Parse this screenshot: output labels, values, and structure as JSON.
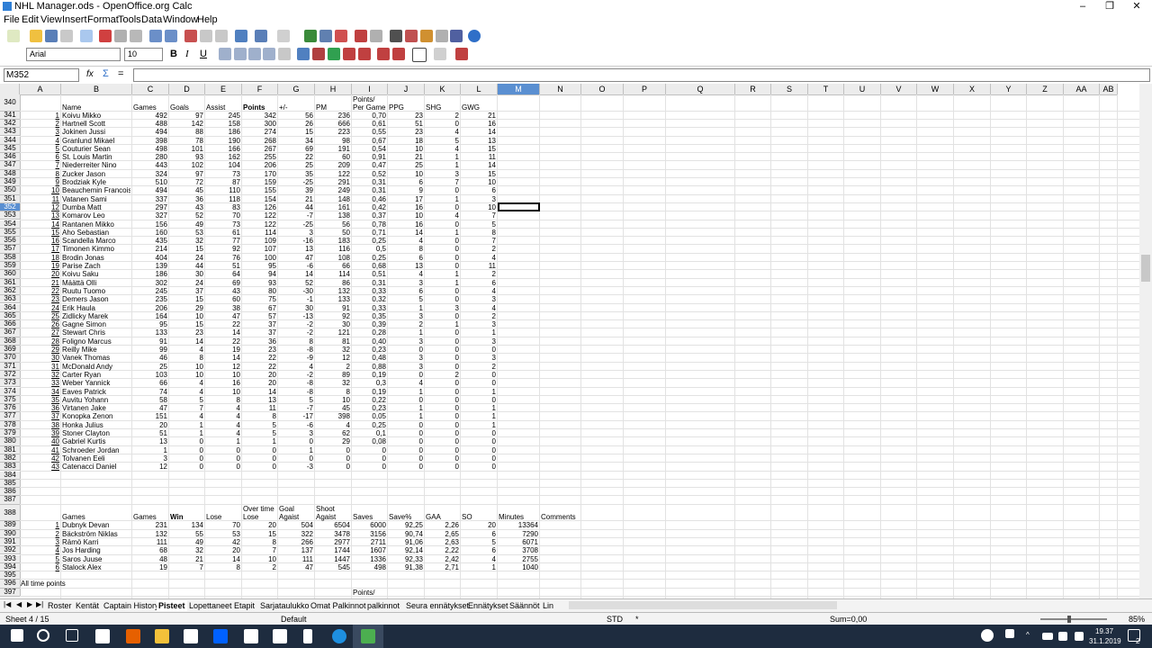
{
  "window": {
    "title": "NHL Manager.ods - OpenOffice.org Calc",
    "min": "–",
    "max": "❐",
    "close": "✕"
  },
  "menu": [
    "File",
    "Edit",
    "View",
    "Insert",
    "Format",
    "Tools",
    "Data",
    "Window",
    "Help"
  ],
  "format_toolbar": {
    "font": "Arial",
    "size": "10",
    "bold": "B",
    "italic": "I",
    "underline": "U"
  },
  "formula_bar": {
    "cell_ref": "M352",
    "fx": "fx",
    "sum": "Σ",
    "eq": "=",
    "value": ""
  },
  "columns": [
    {
      "label": "",
      "w": 22
    },
    {
      "label": "A",
      "w": 46
    },
    {
      "label": "B",
      "w": 79
    },
    {
      "label": "C",
      "w": 41
    },
    {
      "label": "D",
      "w": 40
    },
    {
      "label": "E",
      "w": 41
    },
    {
      "label": "F",
      "w": 40
    },
    {
      "label": "G",
      "w": 41
    },
    {
      "label": "H",
      "w": 41
    },
    {
      "label": "I",
      "w": 40
    },
    {
      "label": "J",
      "w": 41
    },
    {
      "label": "K",
      "w": 40
    },
    {
      "label": "L",
      "w": 41
    },
    {
      "label": "M",
      "w": 47
    },
    {
      "label": "N",
      "w": 46
    },
    {
      "label": "O",
      "w": 47
    },
    {
      "label": "P",
      "w": 47
    },
    {
      "label": "Q",
      "w": 77
    },
    {
      "label": "R",
      "w": 40
    },
    {
      "label": "S",
      "w": 41
    },
    {
      "label": "T",
      "w": 40
    },
    {
      "label": "U",
      "w": 41
    },
    {
      "label": "V",
      "w": 40
    },
    {
      "label": "W",
      "w": 41
    },
    {
      "label": "X",
      "w": 41
    },
    {
      "label": "Y",
      "w": 40
    },
    {
      "label": "Z",
      "w": 41
    },
    {
      "label": "AA",
      "w": 40
    },
    {
      "label": "AB",
      "w": 20
    }
  ],
  "skater_header": {
    "row": "340",
    "cols": [
      "Name",
      "Games",
      "Goals",
      "Assist",
      "Points",
      "+/-",
      "PM",
      "Points/\nPer Game",
      "PPG",
      "SHG",
      "GWG"
    ]
  },
  "skaters": [
    [
      "341",
      "1",
      "Koivu Mikko",
      "492",
      "97",
      "245",
      "342",
      "56",
      "236",
      "0,70",
      "23",
      "2",
      "21"
    ],
    [
      "342",
      "2",
      "Hartnell Scott",
      "488",
      "142",
      "158",
      "300",
      "26",
      "666",
      "0,61",
      "51",
      "0",
      "16"
    ],
    [
      "343",
      "3",
      "Jokinen Jussi",
      "494",
      "88",
      "186",
      "274",
      "15",
      "223",
      "0,55",
      "23",
      "4",
      "14"
    ],
    [
      "344",
      "4",
      "Granlund Mikael",
      "398",
      "78",
      "190",
      "268",
      "34",
      "98",
      "0,67",
      "18",
      "5",
      "13"
    ],
    [
      "345",
      "5",
      "Couturier Sean",
      "498",
      "101",
      "166",
      "267",
      "69",
      "191",
      "0,54",
      "10",
      "4",
      "15"
    ],
    [
      "346",
      "6",
      "St. Louis Martin",
      "280",
      "93",
      "162",
      "255",
      "22",
      "60",
      "0,91",
      "21",
      "1",
      "11"
    ],
    [
      "347",
      "7",
      "Niederreiter Nino",
      "443",
      "102",
      "104",
      "206",
      "25",
      "209",
      "0,47",
      "25",
      "1",
      "14"
    ],
    [
      "348",
      "8",
      "Zucker Jason",
      "324",
      "97",
      "73",
      "170",
      "35",
      "122",
      "0,52",
      "10",
      "3",
      "15"
    ],
    [
      "349",
      "9",
      "Brodziak Kyle",
      "510",
      "72",
      "87",
      "159",
      "-25",
      "291",
      "0,31",
      "6",
      "7",
      "10"
    ],
    [
      "350",
      "10",
      "Beauchemin Francois",
      "494",
      "45",
      "110",
      "155",
      "39",
      "249",
      "0,31",
      "9",
      "0",
      "6"
    ],
    [
      "351",
      "11",
      "Vatanen Sami",
      "337",
      "36",
      "118",
      "154",
      "21",
      "148",
      "0,46",
      "17",
      "1",
      "3"
    ],
    [
      "352",
      "12",
      "Dumba Matt",
      "297",
      "43",
      "83",
      "126",
      "44",
      "161",
      "0,42",
      "16",
      "0",
      "10"
    ],
    [
      "353",
      "13",
      "Komarov Leo",
      "327",
      "52",
      "70",
      "122",
      "-7",
      "138",
      "0,37",
      "10",
      "4",
      "7"
    ],
    [
      "354",
      "14",
      "Rantanen Mikko",
      "156",
      "49",
      "73",
      "122",
      "-25",
      "56",
      "0,78",
      "16",
      "0",
      "5"
    ],
    [
      "355",
      "15",
      "Aho Sebastian",
      "160",
      "53",
      "61",
      "114",
      "3",
      "50",
      "0,71",
      "14",
      "1",
      "8"
    ],
    [
      "356",
      "16",
      "Scandella Marco",
      "435",
      "32",
      "77",
      "109",
      "-16",
      "183",
      "0,25",
      "4",
      "0",
      "7"
    ],
    [
      "357",
      "17",
      "Timonen Kimmo",
      "214",
      "15",
      "92",
      "107",
      "13",
      "116",
      "0,5",
      "8",
      "0",
      "2"
    ],
    [
      "358",
      "18",
      "Brodin Jonas",
      "404",
      "24",
      "76",
      "100",
      "47",
      "108",
      "0,25",
      "6",
      "0",
      "4"
    ],
    [
      "359",
      "19",
      "Parise Zach",
      "139",
      "44",
      "51",
      "95",
      "-6",
      "66",
      "0,68",
      "13",
      "0",
      "11"
    ],
    [
      "360",
      "20",
      "Koivu Saku",
      "186",
      "30",
      "64",
      "94",
      "14",
      "114",
      "0,51",
      "4",
      "1",
      "2"
    ],
    [
      "361",
      "21",
      "Määttä Olli",
      "302",
      "24",
      "69",
      "93",
      "52",
      "86",
      "0,31",
      "3",
      "1",
      "6"
    ],
    [
      "362",
      "22",
      "Ruutu Tuomo",
      "245",
      "37",
      "43",
      "80",
      "-30",
      "132",
      "0,33",
      "6",
      "0",
      "4"
    ],
    [
      "363",
      "23",
      "Demers Jason",
      "235",
      "15",
      "60",
      "75",
      "-1",
      "133",
      "0,32",
      "5",
      "0",
      "3"
    ],
    [
      "364",
      "24",
      "Erik Haula",
      "206",
      "29",
      "38",
      "67",
      "30",
      "91",
      "0,33",
      "1",
      "3",
      "4"
    ],
    [
      "365",
      "25",
      "Zidlicky Marek",
      "164",
      "10",
      "47",
      "57",
      "-13",
      "92",
      "0,35",
      "3",
      "0",
      "2"
    ],
    [
      "366",
      "26",
      "Gagne Simon",
      "95",
      "15",
      "22",
      "37",
      "-2",
      "30",
      "0,39",
      "2",
      "1",
      "3"
    ],
    [
      "367",
      "27",
      "Stewart Chris",
      "133",
      "23",
      "14",
      "37",
      "-2",
      "121",
      "0,28",
      "1",
      "0",
      "1"
    ],
    [
      "368",
      "28",
      "Foligno Marcus",
      "91",
      "14",
      "22",
      "36",
      "8",
      "81",
      "0,40",
      "3",
      "0",
      "3"
    ],
    [
      "369",
      "29",
      "Reilly Mike",
      "99",
      "4",
      "19",
      "23",
      "-8",
      "32",
      "0,23",
      "0",
      "0",
      "0"
    ],
    [
      "370",
      "30",
      "Vanek Thomas",
      "46",
      "8",
      "14",
      "22",
      "-9",
      "12",
      "0,48",
      "3",
      "0",
      "3"
    ],
    [
      "371",
      "31",
      "McDonald Andy",
      "25",
      "10",
      "12",
      "22",
      "4",
      "2",
      "0,88",
      "3",
      "0",
      "2"
    ],
    [
      "372",
      "32",
      "Carter Ryan",
      "103",
      "10",
      "10",
      "20",
      "-2",
      "89",
      "0,19",
      "0",
      "2",
      "0"
    ],
    [
      "373",
      "33",
      "Weber Yannick",
      "66",
      "4",
      "16",
      "20",
      "-8",
      "32",
      "0,3",
      "4",
      "0",
      "0"
    ],
    [
      "374",
      "34",
      "Eaves Patrick",
      "74",
      "4",
      "10",
      "14",
      "-8",
      "8",
      "0,19",
      "1",
      "0",
      "1"
    ],
    [
      "375",
      "35",
      "Auvitu Yohann",
      "58",
      "5",
      "8",
      "13",
      "5",
      "10",
      "0,22",
      "0",
      "0",
      "0"
    ],
    [
      "376",
      "36",
      "Virtanen Jake",
      "47",
      "7",
      "4",
      "11",
      "-7",
      "45",
      "0,23",
      "1",
      "0",
      "1"
    ],
    [
      "377",
      "37",
      "Konopka Zenon",
      "151",
      "4",
      "4",
      "8",
      "-17",
      "398",
      "0,05",
      "1",
      "0",
      "1"
    ],
    [
      "378",
      "38",
      "Honka Julius",
      "20",
      "1",
      "4",
      "5",
      "-6",
      "4",
      "0,25",
      "0",
      "0",
      "1"
    ],
    [
      "379",
      "39",
      "Stoner Clayton",
      "51",
      "1",
      "4",
      "5",
      "3",
      "62",
      "0,1",
      "0",
      "0",
      "0"
    ],
    [
      "380",
      "40",
      "Gabriel Kurtis",
      "13",
      "0",
      "1",
      "1",
      "0",
      "29",
      "0,08",
      "0",
      "0",
      "0"
    ],
    [
      "381",
      "41",
      "Schroeder Jordan",
      "1",
      "0",
      "0",
      "0",
      "1",
      "0",
      "0",
      "0",
      "0",
      "0"
    ],
    [
      "382",
      "42",
      "Tolvanen Eeli",
      "3",
      "0",
      "0",
      "0",
      "0",
      "0",
      "0",
      "0",
      "0",
      "0"
    ],
    [
      "383",
      "43",
      "Catenacci Daniel",
      "12",
      "0",
      "0",
      "0",
      "-3",
      "0",
      "0",
      "0",
      "0",
      "0"
    ]
  ],
  "empty_rows": [
    "384",
    "385",
    "386",
    "387"
  ],
  "goalie_header": {
    "row": "388",
    "cols": [
      "Games",
      "Games",
      "Win",
      "Lose",
      "Over time\nLose",
      "Goal\nAgaist",
      "Shoot\nAgaist",
      "Saves",
      "Save%",
      "GAA",
      "SO",
      "Minutes",
      "Comments"
    ]
  },
  "goalies": [
    [
      "389",
      "1",
      "Dubnyk Devan",
      "231",
      "134",
      "70",
      "20",
      "504",
      "6504",
      "6000",
      "92,25",
      "2,26",
      "20",
      "13364"
    ],
    [
      "390",
      "2",
      "Bäckström Niklas",
      "132",
      "55",
      "53",
      "15",
      "322",
      "3478",
      "3156",
      "90,74",
      "2,65",
      "6",
      "7290"
    ],
    [
      "391",
      "3",
      "Rämö Karri",
      "111",
      "49",
      "42",
      "8",
      "266",
      "2977",
      "2711",
      "91,06",
      "2,63",
      "5",
      "6071"
    ],
    [
      "392",
      "4",
      "Jos Harding",
      "68",
      "32",
      "20",
      "7",
      "137",
      "1744",
      "1607",
      "92,14",
      "2,22",
      "6",
      "3708"
    ],
    [
      "393",
      "5",
      "Saros Juuse",
      "48",
      "21",
      "14",
      "10",
      "111",
      "1447",
      "1336",
      "92,33",
      "2,42",
      "4",
      "2755"
    ],
    [
      "394",
      "6",
      "Stalock Alex",
      "19",
      "7",
      "8",
      "2",
      "47",
      "545",
      "498",
      "91,38",
      "2,71",
      "1",
      "1040"
    ]
  ],
  "tail_rows": [
    {
      "row": "395",
      "text": ""
    },
    {
      "row": "396",
      "text": "All time points"
    },
    {
      "row": "397",
      "text": "Points/"
    }
  ],
  "sheet_tabs": [
    "Roster",
    "Kentät",
    "Captain History",
    "Pisteet",
    "Lopettaneet",
    "Etapit",
    "Sarjataulukko",
    "Omat Palkinnot",
    "palkinnot",
    "Seura ennätykset",
    "Ennätykset",
    "Säännöt",
    "Lin"
  ],
  "active_tab": "Pisteet",
  "status": {
    "sheet": "Sheet 4 / 15",
    "style": "Default",
    "mode": "STD",
    "star": "*",
    "sum": "Sum=0,00",
    "zoom": "85%"
  },
  "taskbar": {
    "time": "19.37",
    "date": "31.1.2019",
    "notifications": "2"
  },
  "colors": {
    "accent": "#5a8fd1",
    "taskbar": "#1e2c3f",
    "header_bg": "#ececec"
  }
}
